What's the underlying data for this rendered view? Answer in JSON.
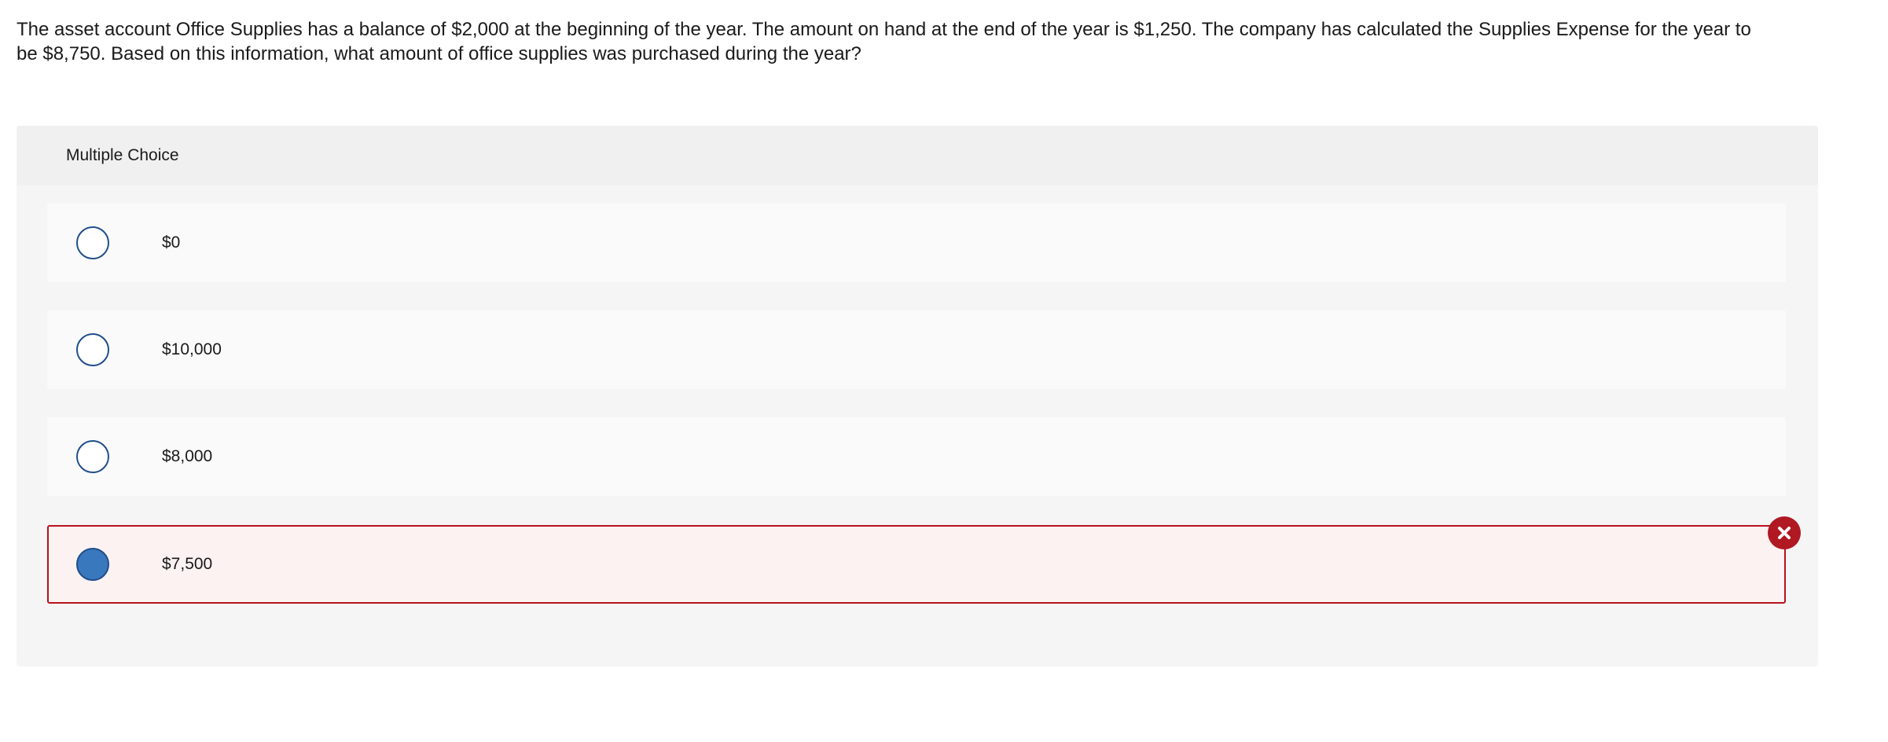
{
  "question": {
    "text": "The asset account Office Supplies has a balance of $2,000 at the beginning of the year. The amount on hand at the end of the year is $1,250. The company has calculated the Supplies Expense for the year to be $8,750. Based on this information, what amount of office supplies was purchased during the year?"
  },
  "multiple_choice": {
    "header": "Multiple Choice",
    "choices": [
      {
        "label": "$0",
        "selected": false
      },
      {
        "label": "$10,000",
        "selected": false
      },
      {
        "label": "$8,000",
        "selected": false
      },
      {
        "label": "$7,500",
        "selected": true,
        "status": "incorrect"
      }
    ],
    "incorrect_icon": "close-x-circle-icon"
  },
  "colors": {
    "radio_border": "#1f4e8c",
    "radio_selected_fill": "#3a78bd",
    "incorrect_border": "#b8121c",
    "incorrect_background": "#fdf2f2",
    "incorrect_badge": "#b01822",
    "panel_background": "#f5f5f5",
    "header_background": "#f0f0f0",
    "choice_background": "#fafafa"
  }
}
